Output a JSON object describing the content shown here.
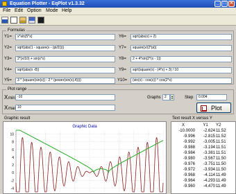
{
  "window": {
    "title": "Equation Plotter - EqPlot v1.3.32",
    "minimize_glyph": "_",
    "maximize_glyph": "□",
    "close_glyph": "✕"
  },
  "menu": [
    {
      "label": "File"
    },
    {
      "label": "Edit"
    },
    {
      "label": "Option"
    },
    {
      "label": "Mode"
    },
    {
      "label": "Help"
    }
  ],
  "toolbar": {
    "icons": [
      "new-icon",
      "open-icon",
      "folder-icon",
      "save-icon",
      "print-icon"
    ]
  },
  "formulas": {
    "group_label": "Formulas",
    "rows": [
      {
        "label": "Y1=",
        "value": "x*sin(5*x)"
      },
      {
        "label": "Y2=",
        "value": "sqrt(abs(1 - square(x - (pi/2))))"
      },
      {
        "label": "Y3=",
        "value": "2*(x/10) + sin(x*x)"
      },
      {
        "label": "Y4=",
        "value": "sqrt(abs(x -8))"
      },
      {
        "label": "Y5=",
        "value": "3 * (square(sin(x)) - 2 * (power(sin(x),4))))"
      },
      {
        "label": "Y6=",
        "value": "sqrt(abs(x) + 2)"
      },
      {
        "label": "Y7=",
        "value": "square(x/(2*pi))"
      },
      {
        "label": "Y8=",
        "value": "2 + 4*sin(2*(x - 1))"
      },
      {
        "label": "Y9=",
        "value": "sqrt(square(x) - (4*x) + 3) / 10"
      },
      {
        "label": "Y10=",
        "value": "(sin(x) - cos(x)) * cos(2*x)"
      }
    ]
  },
  "plot_range": {
    "group_label": "Plot range",
    "xmin_label": "min",
    "xmin_value": "-10",
    "xmax_label": "max",
    "xmax_value": "10",
    "graphs_label": "Graphs",
    "graphs_value": "2",
    "step_label": "Step",
    "step_value": "0.004",
    "plot_button": "Plot"
  },
  "graph": {
    "section_label": "Graphic result",
    "title": "Graphic Data",
    "y_ticks": [
      "10",
      "8",
      "6",
      "4",
      "2",
      "0",
      "-2",
      "-4"
    ],
    "series_colors": {
      "y1": "#8b1a1a",
      "y2": "#22aa22"
    }
  },
  "chart_data": {
    "type": "line",
    "title": "Graphic Data",
    "xlabel": "",
    "ylabel": "",
    "xlim": [
      -10,
      10
    ],
    "ylim": [
      -5,
      11
    ],
    "y_ticks": [
      10,
      8,
      6,
      4,
      2,
      0,
      -2,
      -4
    ],
    "grid": true,
    "legend": "none",
    "series": [
      {
        "formula": "x*sin(5*x)",
        "color": "#8b1a1a",
        "x": [
          -10,
          -9.993,
          -9.976,
          -9.96
        ],
        "y": [
          -2.624,
          -2.815,
          -3.194,
          -4.293
        ]
      },
      {
        "formula": "sqrt(abs(1 - square(x - (pi/2))))",
        "color": "#22aa22",
        "x": [
          -10,
          -9.993,
          -9.976,
          -9.96
        ],
        "y": [
          11.52,
          11.519,
          11.515,
          11.503
        ]
      }
    ]
  },
  "table": {
    "section_label": "Text result X versus Y",
    "headers": [
      "X",
      "Y1",
      "Y2"
    ],
    "rows": [
      [
        "-10.0000",
        "-2.624",
        "11.52"
      ],
      [
        "-9.996",
        "-2.815",
        "11.52"
      ],
      [
        "-9.992",
        "-3.005",
        "11.51"
      ],
      [
        "-9.988",
        "-3.194",
        "11.51"
      ],
      [
        "-9.984",
        "-3.381",
        "11.51"
      ],
      [
        "-9.980",
        "-3.567",
        "11.50"
      ],
      [
        "-9.976",
        "-3.751",
        "11.50"
      ],
      [
        "-9.972",
        "-3.934",
        "11.50"
      ],
      [
        "-9.968",
        "-4.114",
        "11.49"
      ],
      [
        "-9.964",
        "-4.293",
        "11.49"
      ],
      [
        "-9.960",
        "-4.470",
        "11.49"
      ]
    ]
  }
}
